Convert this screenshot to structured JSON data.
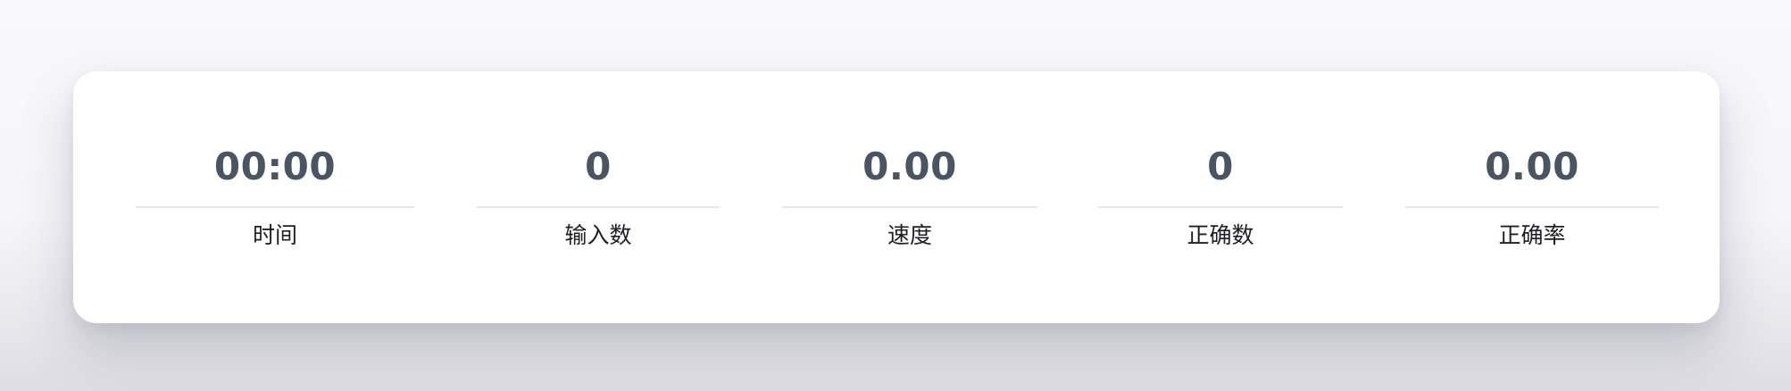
{
  "stats": [
    {
      "value": "00:00",
      "label": "时间"
    },
    {
      "value": "0",
      "label": "输入数"
    },
    {
      "value": "0.00",
      "label": "速度"
    },
    {
      "value": "0",
      "label": "正确数"
    },
    {
      "value": "0.00",
      "label": "正确率"
    }
  ],
  "colors": {
    "value_text": "#4a5563",
    "label_text": "#1f1f23",
    "divider": "#e6e6ea",
    "card_background": "#ffffff",
    "page_background": "#f8f8fc"
  }
}
